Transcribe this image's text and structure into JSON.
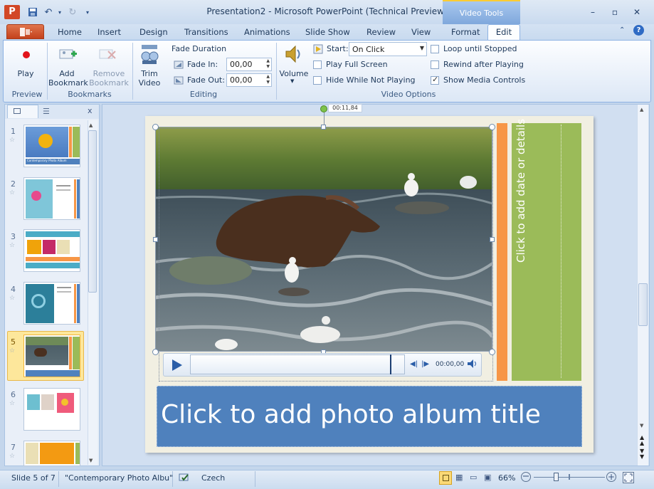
{
  "window": {
    "title": "Presentation2 - Microsoft PowerPoint (Technical Preview)",
    "contextual_tab_group": "Video Tools"
  },
  "tabs": [
    "File",
    "Home",
    "Insert",
    "Design",
    "Transitions",
    "Animations",
    "Slide Show",
    "Review",
    "View",
    "Format",
    "Edit"
  ],
  "active_tab": "Edit",
  "ribbon": {
    "preview": {
      "play_label": "Play",
      "group_label": "Preview"
    },
    "bookmarks": {
      "add_label_1": "Add",
      "add_label_2": "Bookmark",
      "remove_label_1": "Remove",
      "remove_label_2": "Bookmark",
      "group_label": "Bookmarks"
    },
    "editing": {
      "trim_label_1": "Trim",
      "trim_label_2": "Video",
      "fade_duration": "Fade Duration",
      "fade_in_label": "Fade In:",
      "fade_in_value": "00,00",
      "fade_out_label": "Fade Out:",
      "fade_out_value": "00,00",
      "group_label": "Editing"
    },
    "video_options": {
      "volume_label": "Volume",
      "start_label": "Start:",
      "start_value": "On Click",
      "play_full_screen": "Play Full Screen",
      "hide_while_not_playing": "Hide While Not Playing",
      "loop_until_stopped": "Loop until Stopped",
      "rewind_after_playing": "Rewind after Playing",
      "show_media_controls": "Show Media Controls",
      "group_label": "Video Options"
    }
  },
  "slides": [
    {
      "num": "1",
      "caption": "Contemporary Photo Album"
    },
    {
      "num": "2"
    },
    {
      "num": "3"
    },
    {
      "num": "4"
    },
    {
      "num": "5"
    },
    {
      "num": "6"
    },
    {
      "num": "7"
    }
  ],
  "selected_slide": "5",
  "slide": {
    "date_placeholder": "Click to add date or details",
    "title_placeholder": "Click to add photo album title",
    "timecode_tooltip": "00:11,84",
    "player_time": "00:00,00"
  },
  "statusbar": {
    "slide_info": "Slide 5 of 7",
    "theme": "\"Contemporary Photo Albu\"",
    "language": "Czech",
    "zoom": "66%"
  }
}
